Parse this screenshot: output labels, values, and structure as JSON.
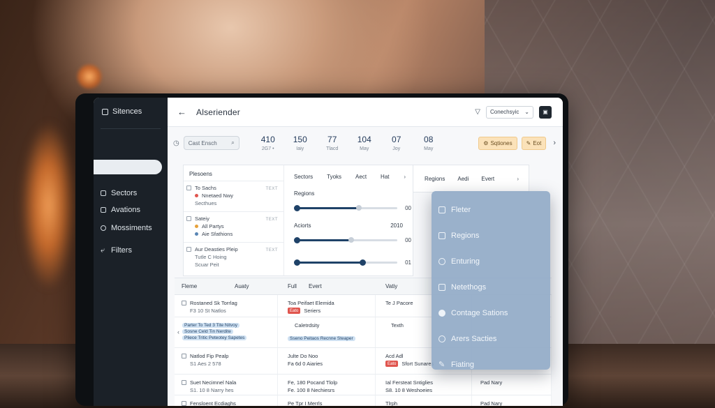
{
  "sidebar": {
    "brand": "Sitences",
    "items": [
      {
        "label": "Sectors",
        "icon": "layers-icon"
      },
      {
        "label": "Avations",
        "icon": "grid-icon"
      },
      {
        "label": "Mossiments",
        "icon": "circle-icon"
      },
      {
        "label": "Filters",
        "icon": "arrow-icon"
      }
    ]
  },
  "topbar": {
    "back": "←",
    "title": "Alseriender",
    "select_value": "Conechsyic"
  },
  "stats_row": {
    "search_placeholder": "Cast Ensch",
    "stats": [
      {
        "value": "410",
        "label": "2G7 •"
      },
      {
        "value": "150",
        "label": "Iaiy"
      },
      {
        "value": "77",
        "label": "Tlacd"
      },
      {
        "value": "104",
        "label": "May"
      },
      {
        "value": "07",
        "label": "Joy"
      },
      {
        "value": "08",
        "label": "May"
      }
    ],
    "button_a": "Sqtiones",
    "button_b": "Eot"
  },
  "list_panel": {
    "title": "Plesoens",
    "groups": [
      {
        "title": "To Sachs",
        "line1": "Nnetaed Nwy",
        "line2": "Secthues",
        "tag": "TEXT",
        "bullet": "#e0554e"
      },
      {
        "title": "Sateiy",
        "line1": "All Partys",
        "line2": "Aie Sfathions",
        "tag": "TEXT",
        "bullet": "#e7a13a"
      },
      {
        "title": "Aur Deasties Pleip",
        "line1": "Tutle C Hoing",
        "line2": "Scuar Peit",
        "tag": "TEXT",
        "bullet": ""
      }
    ]
  },
  "slider_panel": {
    "tabs": [
      "Sectors",
      "Tyoks",
      "Aect",
      "Hat"
    ],
    "label1": "Regions",
    "label2": "Aciorts",
    "label2_value": "2010",
    "slider1": {
      "value": "00",
      "fill": 0.62
    },
    "slider2": {
      "value": "00",
      "fill": 0.55
    },
    "slider3": {
      "value": "01",
      "fill": 0.66
    }
  },
  "right_tabs": [
    "Regions",
    "Aedi",
    "Evert"
  ],
  "table": {
    "headers": [
      "Fleme",
      "Auaty",
      "Full",
      "Evert",
      "Vatiy"
    ],
    "rows": [
      {
        "c1": [
          "Rostaned Sk Torrlag",
          "F3 10 St Natlos"
        ],
        "c2": [
          "Toa Peifaet Elemida",
          "Seriers"
        ],
        "c2_badge": "Eato",
        "c3": [
          "Te J Pacore",
          ""
        ]
      },
      {
        "c1_hl": [
          "Parter To Ted 3 Tite Nitvoy",
          "Sosne Celd Tin Nerdite",
          "Pliece Tritic Peteotey Sapetes"
        ],
        "c2": [
          "Caletrdsity",
          ""
        ],
        "c2_hl": "Sseno Peitaos Recnne Steaper",
        "c3": [
          "Texth",
          ""
        ]
      },
      {
        "c1": [
          "Natlod Fip Pealp",
          "S1 Aes 2 578"
        ],
        "c2": [
          "Julte Do Noo",
          "Fa 6d 0 Aiaries"
        ],
        "c3": [
          "Acd Adl",
          "Sfort Sunares"
        ],
        "c3_badge": "Eato"
      },
      {
        "c1": [
          "Suet Necimnel Nala",
          "S1. 10 8 Narry hes"
        ],
        "c2": [
          "Fe, 180 Pocand Tlolp",
          "Fe. 100 8 Nechiesrs"
        ],
        "c3": [
          "Ial Fersteat Sntiglies",
          "S8. 10 8 Weshoeies"
        ],
        "c4": [
          "Pad Nary",
          ""
        ]
      },
      {
        "c1": [
          "Fensloent Ecdiaghs",
          ""
        ],
        "c2": [
          "Pe Tpr I Merrls",
          ""
        ],
        "c3": [
          "Tlrph",
          ""
        ],
        "c4": [
          "Pad Nary",
          ""
        ]
      }
    ]
  },
  "menu": {
    "items": [
      {
        "label": "Fleter",
        "icon": "grid-icon"
      },
      {
        "label": "Regions",
        "icon": "grid-icon"
      },
      {
        "label": "Enturing",
        "icon": "globe-icon"
      },
      {
        "label": "Netethogs",
        "icon": "card-icon"
      },
      {
        "label": "Contage Sations",
        "icon": "info-icon"
      },
      {
        "label": "Arers Sacties",
        "icon": "clock-icon"
      },
      {
        "label": "Fiating",
        "icon": "pencil-icon"
      }
    ]
  }
}
